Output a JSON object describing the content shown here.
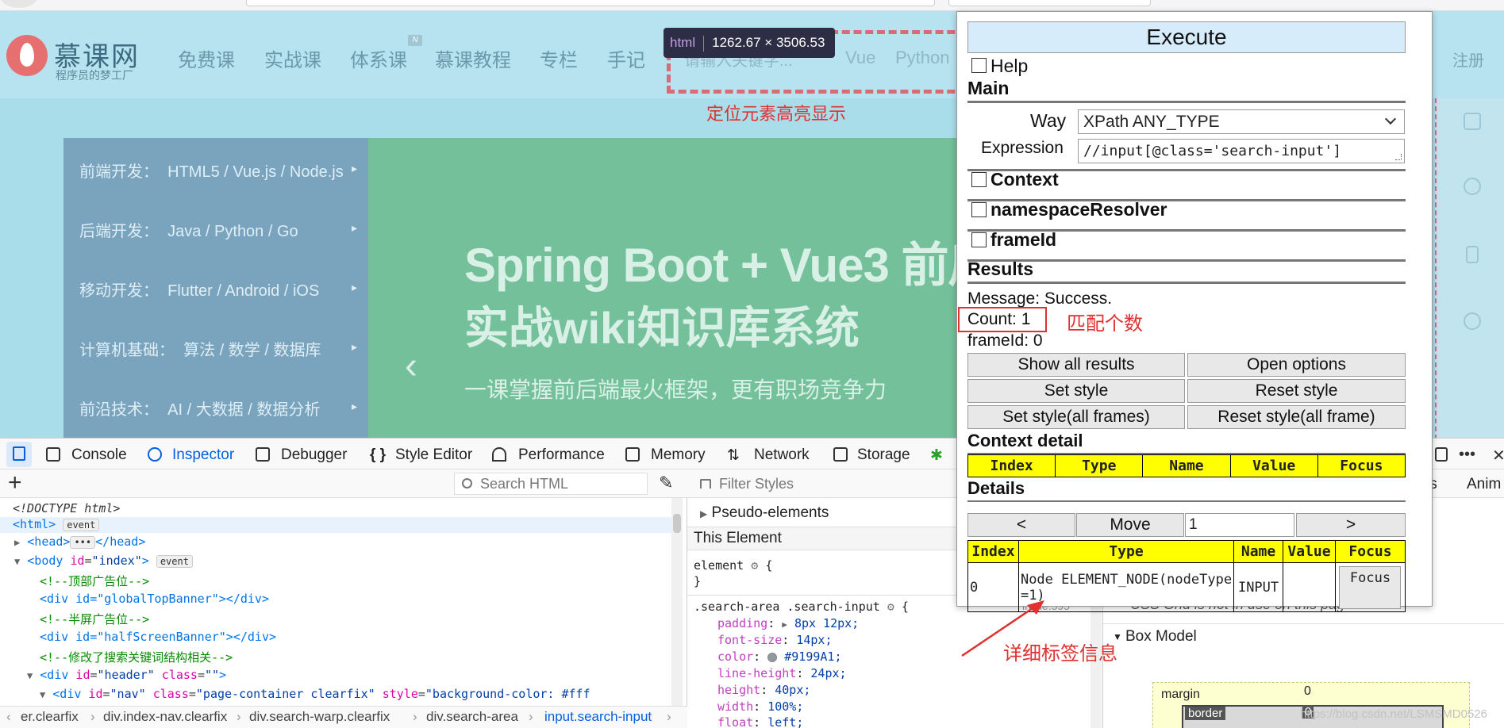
{
  "site": {
    "logo_text": "慕课网",
    "logo_sub": "程序员的梦工厂",
    "nav": [
      "免费课",
      "实战课",
      "体系课",
      "慕课教程",
      "专栏",
      "手记"
    ],
    "nav_badge": "N",
    "search_placeholder": "请输入关键字...",
    "nav_right": [
      "Vue",
      "Python"
    ],
    "register": "注册",
    "highlight_note": "定位元素高亮显示",
    "tooltip_tag": "html",
    "tooltip_size": "1262.67 × 3506.53",
    "sidebar": [
      {
        "label": "前端开发：",
        "links": "HTML5 / Vue.js / Node.js"
      },
      {
        "label": "后端开发：",
        "links": "Java / Python / Go"
      },
      {
        "label": "移动开发：",
        "links": "Flutter / Android / iOS"
      },
      {
        "label": "计算机基础：",
        "links": "算法 / 数学 / 数据库"
      },
      {
        "label": "前沿技术：",
        "links": "AI / 大数据 / 数据分析"
      }
    ],
    "banner_title1": "Spring Boot + Vue3 前后",
    "banner_title2": "实战wiki知识库系统",
    "banner_sub": "一课掌握前后端最火框架，更有职场竞争力",
    "arrow_left": "‹"
  },
  "devtools": {
    "tabs": [
      "Console",
      "Inspector",
      "Debugger",
      "Style Editor",
      "Performance",
      "Memory",
      "Network",
      "Storage"
    ],
    "active_tab": "Inspector",
    "more": "•••",
    "close": "✕",
    "search_html_placeholder": "Search HTML",
    "filter_styles_placeholder": "Filter Styles",
    "pseudo_elements": "Pseudo-elements",
    "this_element": "This Element",
    "rule_line_ref": "inline:595",
    "right_tabs": [
      "ts",
      "Anim"
    ],
    "grid_note": "CSS Grid is not in use on this page",
    "box_model": "Box Model",
    "bm_margin": "margin",
    "bm_border": "border",
    "bm_zero": "0",
    "watermark": "https://blog.csdn.net/LSMSMD0526",
    "breadcrumb": [
      "er.clearfix",
      "div.index-nav.clearfix",
      "div.search-warp.clearfix",
      "div.search-area",
      "input.search-input"
    ],
    "code": {
      "doctype": "<!DOCTYPE html>",
      "html_tag": "<html>",
      "event": "event",
      "head_open": "<head>",
      "head_close": "</head>",
      "ellipsis": "•••",
      "body_open": "<body",
      "body_attr": "id",
      "body_val": "\"index\"",
      "body_end": ">",
      "c1": "<!--顶部广告位-->",
      "d1": "<div id=\"globalTopBanner\"></div>",
      "c2": "<!--半屏广告位-->",
      "d2": "<div id=\"halfScreenBanner\"></div>",
      "c3": "<!--修改了搜索关键词结构相关-->",
      "header_open": "<div",
      "header_attr1": "id",
      "header_val1": "\"header\"",
      "header_attr2": "class",
      "header_val2": "\"\"",
      "header_end": ">",
      "nav_line_tag": "<div",
      "nav_line_id": "id",
      "nav_line_idval": "\"nav\"",
      "nav_line_class": "class",
      "nav_line_classval": "\"page-container clearfix\"",
      "nav_line_style": "style",
      "nav_line_styleval": "\"background-color: #fff"
    },
    "rules": {
      "element_sel": "element",
      "open": "{",
      "close": "}",
      "selector": ".search-area .search-input",
      "props": [
        {
          "name": "padding",
          "value": "8px 12px;"
        },
        {
          "name": "font-size",
          "value": "14px;"
        },
        {
          "name": "color",
          "value": "#9199A1;"
        },
        {
          "name": "line-height",
          "value": "24px;"
        },
        {
          "name": "height",
          "value": "40px;"
        },
        {
          "name": "width",
          "value": "100%;"
        },
        {
          "name": "float",
          "value": "left;"
        }
      ]
    }
  },
  "xpath": {
    "execute": "Execute",
    "help": "Help",
    "main": "Main",
    "way_label": "Way",
    "way_value": "XPath ANY_TYPE",
    "expression_label": "Expression",
    "expression_value": "//input[@class='search-input']",
    "context": "Context",
    "namespace_resolver": "namespaceResolver",
    "frame_id": "frameId",
    "results": "Results",
    "message": "Message: Success.",
    "count": "Count: 1",
    "frame_id_value": "frameId: 0",
    "count_note": "匹配个数",
    "buttons": [
      "Show all results",
      "Open options",
      "Set style",
      "Reset style",
      "Set style(all frames)",
      "Reset style(all frame)"
    ],
    "context_detail": "Context detail",
    "context_cols": [
      "Index",
      "Type",
      "Name",
      "Value",
      "Focus"
    ],
    "details": "Details",
    "prev": "<",
    "move": "Move",
    "move_value": "1",
    "next": ">",
    "detail_cols": [
      "Index",
      "Type",
      "Name",
      "Value",
      "Focus"
    ],
    "detail_row": {
      "index": "0",
      "type": "Node ELEMENT_NODE(nodeType=1)",
      "name": "INPUT",
      "value": "",
      "focus": "Focus"
    },
    "detail_note": "详细标签信息"
  },
  "colors": {
    "annotation_red": "#e03030",
    "highlight_yellow": "#ffff00",
    "devtools_blue": "#0060df"
  }
}
